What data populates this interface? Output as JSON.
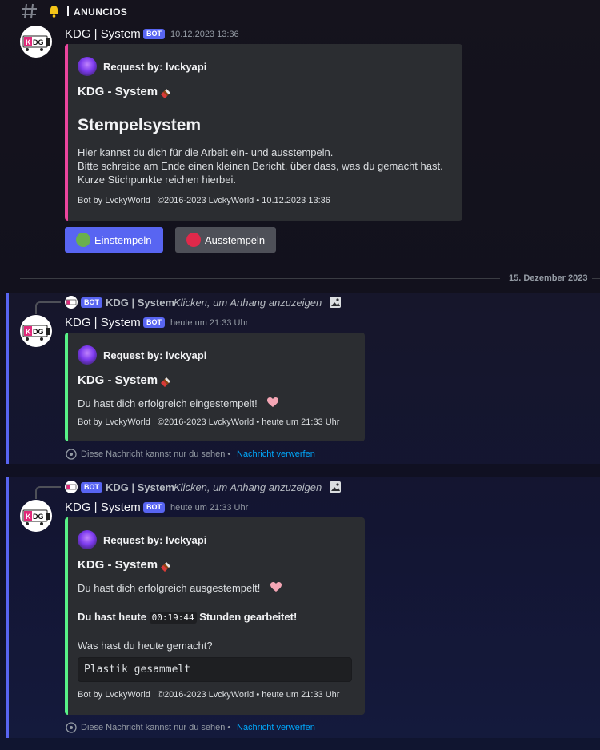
{
  "channel": {
    "name": "ANUNCIOS",
    "icon": "hash-icon",
    "prefix_icon": "bell-icon"
  },
  "colors": {
    "accent": "#5865f2",
    "embed_pink": "#eb459e",
    "embed_green": "#57f287",
    "link": "#00a8fc"
  },
  "messages": [
    {
      "author": "KDG | System",
      "bot_tag": "BOT",
      "timestamp": "10.12.2023 13:36",
      "embed": {
        "author": "Request by: lvckyapi",
        "subtitle": "KDG - System",
        "title": "Stempelsystem",
        "description": [
          "Hier kannst du dich für die Arbeit ein- und ausstempeln.",
          "Bitte schreibe am Ende einen kleinen Bericht, über dass, was du gemacht hast.",
          "Kurze Stichpunkte reichen hierbei."
        ],
        "footer": "Bot by LvckyWorld | ©2016-2023 LvckyWorld • 10.12.2023 13:36"
      },
      "buttons": [
        {
          "label": "Einstempeln",
          "color": "#5865f2",
          "dot": "#6ab04c"
        },
        {
          "label": "Ausstempeln",
          "color": "#4e5058",
          "dot": "#e0294a"
        }
      ]
    },
    {
      "reply": {
        "bot_tag": "BOT",
        "author": "KDG | System",
        "text": "Klicken, um Anhang anzuzeigen"
      },
      "author": "KDG | System",
      "bot_tag": "BOT",
      "timestamp": "heute um 21:33 Uhr",
      "embed": {
        "author": "Request by: lvckyapi",
        "subtitle": "KDG - System",
        "description": "Du hast dich erfolgreich eingestempelt!",
        "footer": "Bot by LvckyWorld | ©2016-2023 LvckyWorld • heute um 21:33 Uhr"
      },
      "ephemeral": {
        "text": "Diese Nachricht kannst nur du sehen •",
        "link": "Nachricht verwerfen"
      }
    },
    {
      "reply": {
        "bot_tag": "BOT",
        "author": "KDG | System",
        "text": "Klicken, um Anhang anzuzeigen"
      },
      "author": "KDG | System",
      "bot_tag": "BOT",
      "timestamp": "heute um 21:33 Uhr",
      "embed": {
        "author": "Request by: lvckyapi",
        "subtitle": "KDG - System",
        "description": "Du hast dich erfolgreich ausgestempelt!",
        "worked_prefix": "Du hast heute",
        "worked_time": "00:19:44",
        "worked_suffix": "Stunden gearbeitet!",
        "question": "Was hast du heute gemacht?",
        "answer": "Plastik gesammelt",
        "footer": "Bot by LvckyWorld | ©2016-2023 LvckyWorld • heute um 21:33 Uhr"
      },
      "ephemeral": {
        "text": "Diese Nachricht kannst nur du sehen •",
        "link": "Nachricht verwerfen"
      }
    }
  ],
  "date_divider": "15. Dezember 2023",
  "avatar_text": "KDG"
}
